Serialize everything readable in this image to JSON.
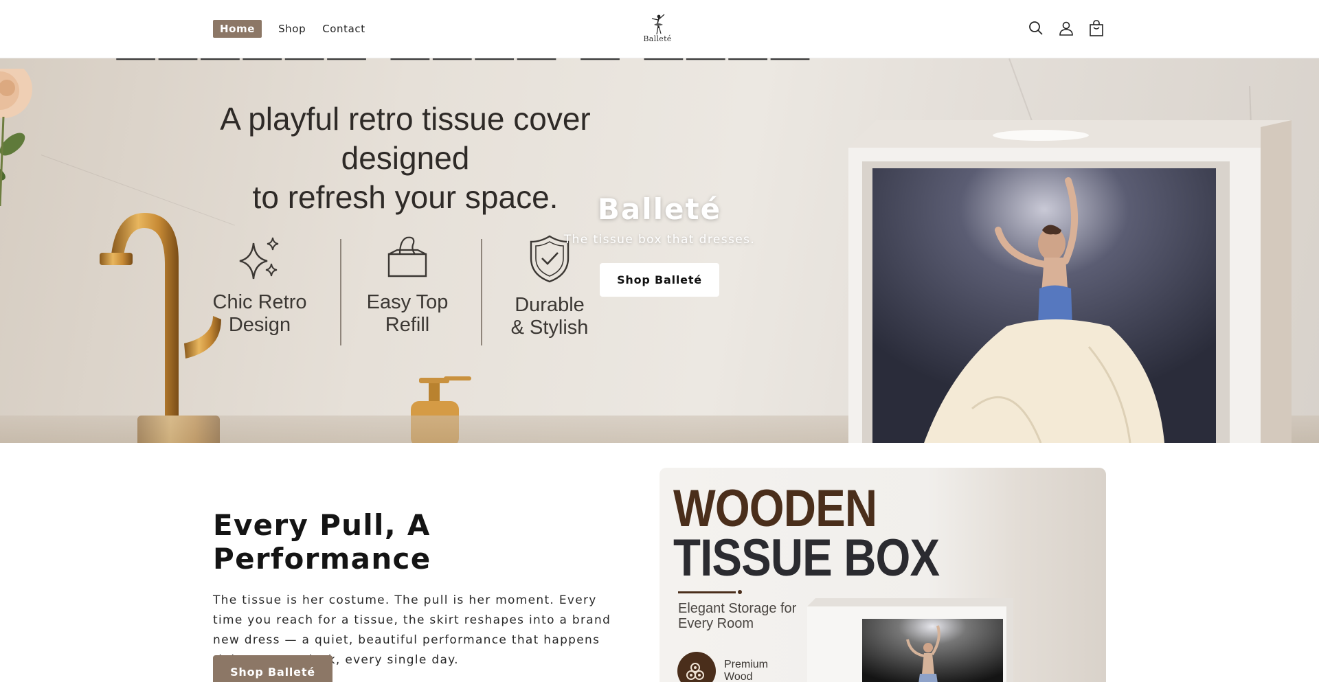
{
  "header": {
    "nav": [
      {
        "label": "Home",
        "active": true
      },
      {
        "label": "Shop",
        "active": false
      },
      {
        "label": "Contact",
        "active": false
      }
    ],
    "logo_text": "Balleté",
    "icons": [
      "search-icon",
      "account-icon",
      "cart-icon"
    ]
  },
  "hero": {
    "image_tagline_line1": "A playful retro tissue cover designed",
    "image_tagline_line2": "to refresh your space.",
    "features": [
      {
        "icon": "sparkle-icon",
        "line1": "Chic Retro",
        "line2": "Design"
      },
      {
        "icon": "tissue-box-icon",
        "line1": "Easy Top",
        "line2": "Refill"
      },
      {
        "icon": "shield-check-icon",
        "line1": "Durable",
        "line2": "& Stylish"
      }
    ],
    "title": "Balleté",
    "subtitle": "The tissue box that dresses.",
    "cta": "Shop Balleté"
  },
  "story": {
    "title": "Every Pull, A Performance",
    "body": "The tissue is her costume. The pull is her moment. Every time you reach for a tissue, the skirt reshapes into a brand new dress — a quiet, beautiful performance that happens right on your desk, every single day.",
    "cta": "Shop Balleté"
  },
  "promo": {
    "headline_line1": "WOODEN",
    "headline_line2": "TISSUE BOX",
    "subtitle": "Elegant Storage for Every Room",
    "badge_label_line1": "Premium",
    "badge_label_line2": "Wood"
  },
  "colors": {
    "accent": "#8c7766",
    "brown": "#4a2e1b",
    "dark": "#141414"
  }
}
